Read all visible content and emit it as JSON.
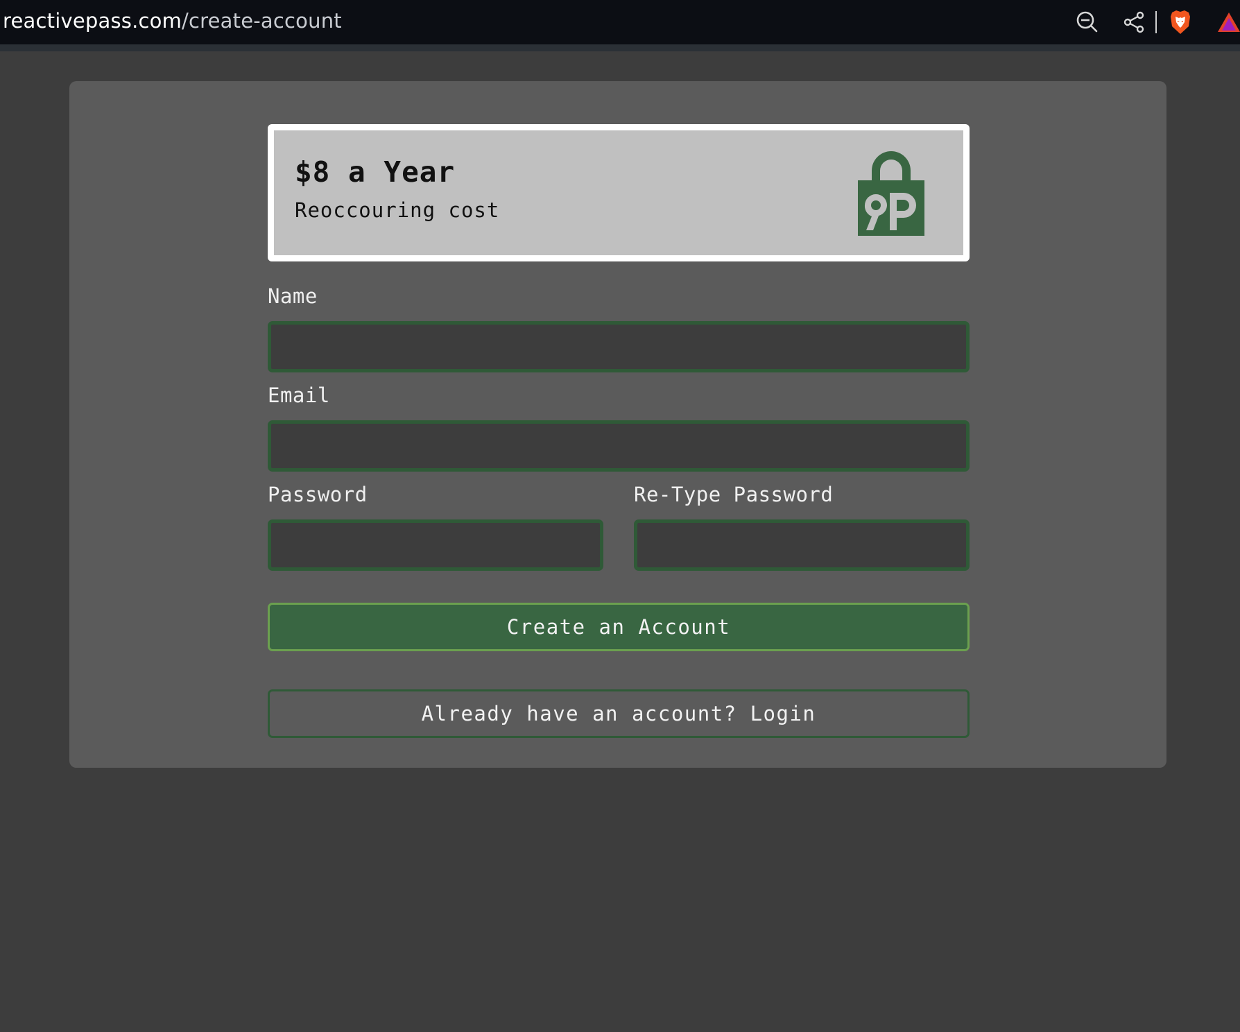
{
  "browser": {
    "url_domain": "reactivepass.com",
    "url_path": "/create-account",
    "icons": [
      "zoom-out-icon",
      "share-icon",
      "brave-shield-icon",
      "brave-rewards-icon"
    ]
  },
  "pricing": {
    "title": "$8 a Year",
    "subtitle": "Reoccouring cost",
    "logo_icon": "reactivepass-lock-logo",
    "logo_color": "#396642"
  },
  "form": {
    "name_label": "Name",
    "name_value": "",
    "email_label": "Email",
    "email_value": "",
    "password_label": "Password",
    "password_value": "",
    "retype_password_label": "Re-Type Password",
    "retype_password_value": ""
  },
  "actions": {
    "create_account_label": "Create an Account",
    "login_label": "Already have an account? Login"
  },
  "colors": {
    "page_background": "#3d3d3d",
    "card_background": "#5b5b5b",
    "accent_green": "#396642",
    "input_border": "#2f5a37"
  }
}
